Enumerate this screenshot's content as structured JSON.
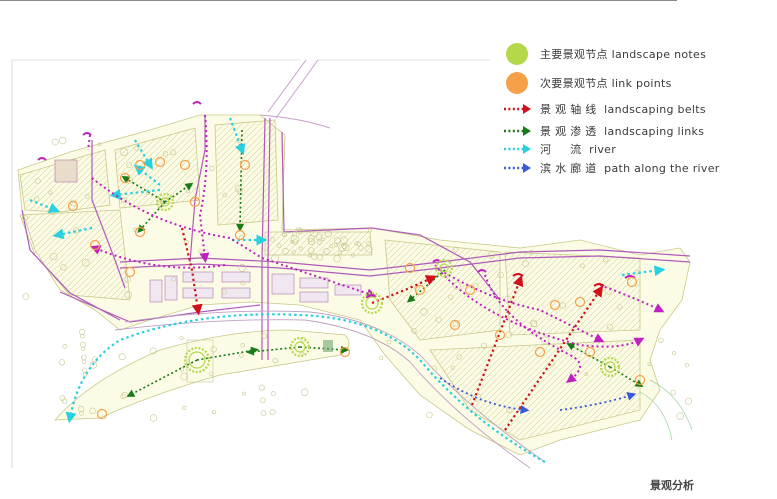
{
  "legend": {
    "items": [
      {
        "symbol": "dot",
        "color": "#b5d84a",
        "label": "主要景观节点 landscape notes"
      },
      {
        "symbol": "dot",
        "color": "#f7a04a",
        "label": "次要景观节点 link points"
      },
      {
        "symbol": "arrow",
        "color": "#d0101a",
        "label": "景 观 轴 线  landscaping belts"
      },
      {
        "symbol": "arrow",
        "color": "#1a7a1a",
        "label": "景 观 渗 透  landscaping links"
      },
      {
        "symbol": "arrow",
        "color": "#28d0e0",
        "label": "河     流  river"
      },
      {
        "symbol": "arrow",
        "color": "#3a5ad8",
        "label": "滨 水 廊 道  path along the river"
      }
    ]
  },
  "caption": "景观分析",
  "colors": {
    "primary_node": "#b5d84a",
    "secondary_node": "#f7a04a",
    "axis": "#d0101a",
    "link": "#1a7a1a",
    "river": "#28d0e0",
    "riverside_path": "#3a5ad8",
    "road": "#b05ab8",
    "base_fill": "#fbfbe6",
    "base_line": "#c9c98a"
  }
}
